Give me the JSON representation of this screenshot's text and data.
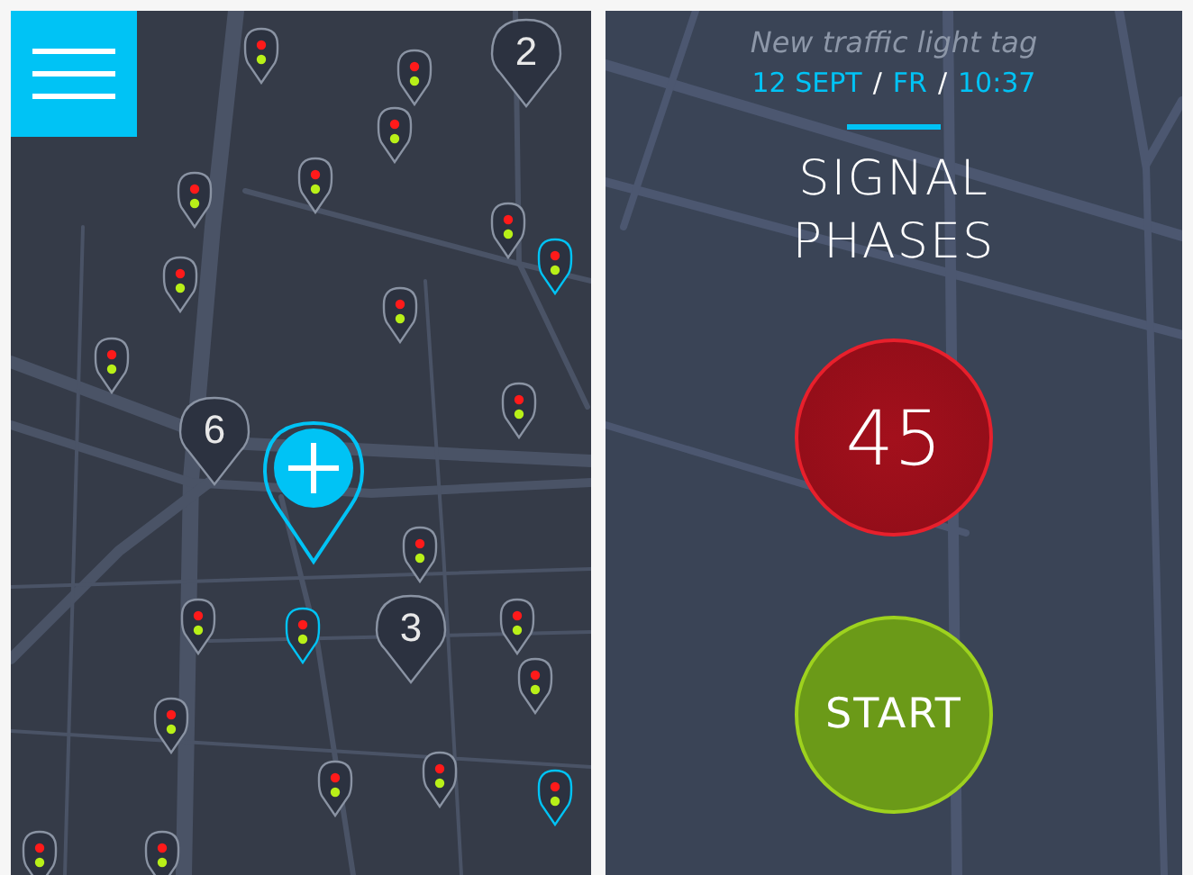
{
  "map_screen": {
    "clusters": [
      {
        "count": "2"
      },
      {
        "count": "6"
      },
      {
        "count": "3"
      }
    ],
    "pins": [
      {
        "selected": false
      },
      {
        "selected": false
      },
      {
        "selected": false
      },
      {
        "selected": false
      },
      {
        "selected": false
      },
      {
        "selected": false
      },
      {
        "selected": true
      },
      {
        "selected": false
      },
      {
        "selected": false
      },
      {
        "selected": false
      },
      {
        "selected": false
      },
      {
        "selected": false
      },
      {
        "selected": false
      },
      {
        "selected": true
      },
      {
        "selected": false
      },
      {
        "selected": false
      },
      {
        "selected": false
      },
      {
        "selected": false
      },
      {
        "selected": false
      },
      {
        "selected": true
      },
      {
        "selected": false
      },
      {
        "selected": false
      }
    ]
  },
  "tag_screen": {
    "title": "New traffic light tag",
    "date": "12 SEPT",
    "separator_1": "/",
    "weekday": "FR",
    "separator_2": "/",
    "time": "10:37",
    "heading": "SIGNAL PHASES",
    "counter": "45",
    "start_button": "START"
  }
}
